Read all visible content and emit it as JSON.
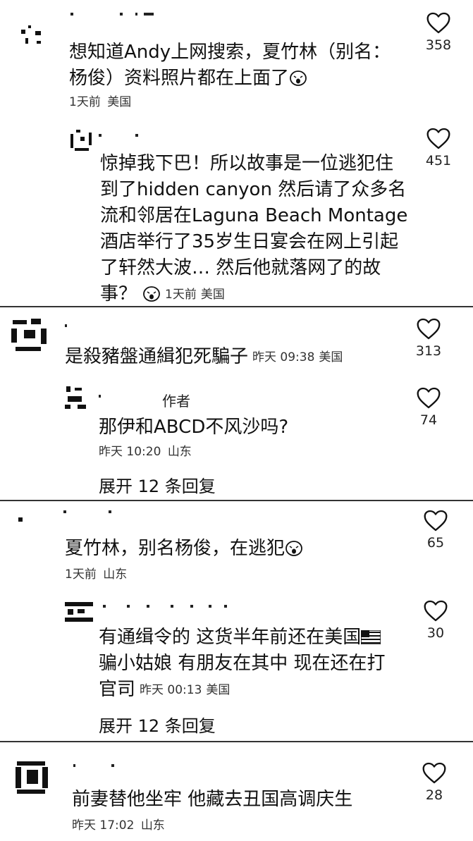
{
  "threads": [
    {
      "comment": {
        "text": "想知道Andy上网搜索，夏竹林（别名：杨俊）资料照片都在上面了",
        "emoji": "weary-face-emoji",
        "time": "1天前",
        "location": "美国",
        "likes": "358"
      },
      "reply": {
        "text": "惊掉我下巴！所以故事是一位逃犯住到了hidden canyon 然后请了众多名流和邻居在Laguna Beach Montage酒店举行了35岁生日宴会在网上引起了轩然大波… 然后他就落网了的故事？",
        "emoji": "weary-face-emoji",
        "time": "1天前",
        "location": "美国",
        "likes": "451"
      }
    },
    {
      "comment": {
        "text": "是殺豬盤通緝犯死騙子",
        "time": "昨天 09:38",
        "location": "美国",
        "likes": "313"
      },
      "reply": {
        "author_tag": "作者",
        "text": "那伊和ABCD不风沙吗?",
        "time": "昨天 10:20",
        "location": "山东",
        "likes": "74"
      },
      "expand": "展开 12 条回复"
    },
    {
      "comment": {
        "text": "夏竹林，别名杨俊，在逃犯",
        "emoji": "weary-face-emoji",
        "time": "1天前",
        "location": "山东",
        "likes": "65"
      },
      "reply": {
        "text": "有通缉令的 这货半年前还在美国",
        "flag": "us-flag-emoji",
        "text2": "骗小姑娘 有朋友在其中 现在还在打官司",
        "time": "昨天 00:13",
        "location": "美国",
        "likes": "30"
      },
      "expand": "展开 12 条回复"
    },
    {
      "comment": {
        "text": "前妻替他坐牢 他藏去丑国高调庆生",
        "time": "昨天 17:02",
        "location": "山东",
        "likes": "28"
      }
    }
  ]
}
